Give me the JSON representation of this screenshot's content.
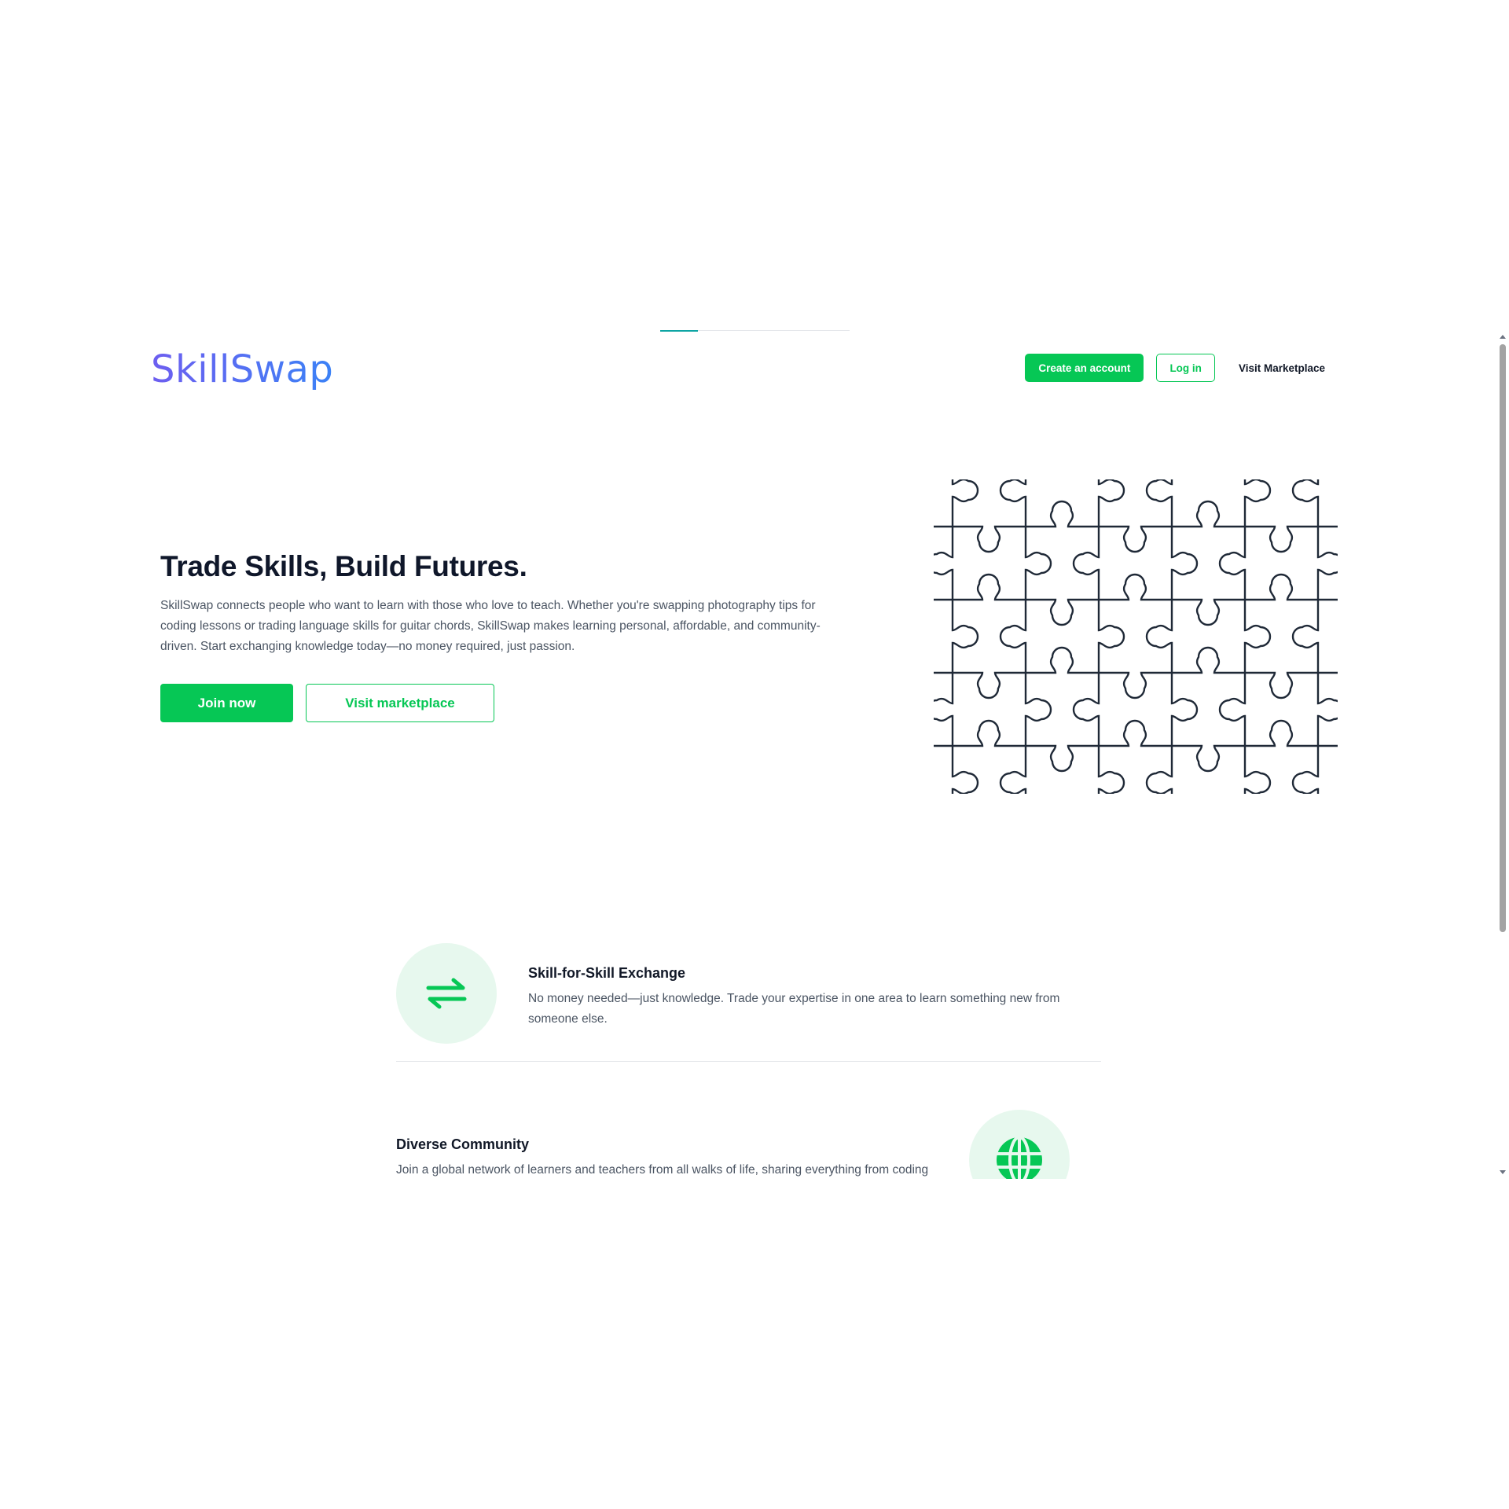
{
  "header": {
    "logo": "SkillSwap",
    "create_account": "Create an account",
    "log_in": "Log in",
    "visit_marketplace": "Visit Marketplace"
  },
  "progress": {
    "fraction": 0.2
  },
  "hero": {
    "title": "Trade Skills, Build Futures.",
    "description": "SkillSwap connects people who want to learn with those who love to teach. Whether you're swapping photography tips for coding lessons or trading language skills for guitar chords, SkillSwap makes learning personal, affordable, and community-driven. Start exchanging knowledge today—no money required, just passion.",
    "join_now": "Join now",
    "visit_marketplace": "Visit marketplace",
    "illustration_icon": "puzzle-pattern-icon"
  },
  "features": [
    {
      "icon": "exchange-arrows-icon",
      "title": "Skill-for-Skill Exchange",
      "description": "No money needed—just knowledge. Trade your expertise in one area to learn something new from someone else."
    },
    {
      "icon": "globe-icon",
      "title": "Diverse Community",
      "description": "Join a global network of learners and teachers from all walks of life, sharing everything from coding"
    }
  ],
  "colors": {
    "accent": "#06c755",
    "accent_light": "#e7f8ee",
    "logo_gradient_start": "#6d5ef0",
    "logo_gradient_end": "#3b82f6",
    "progress": "#0ea5a4"
  }
}
